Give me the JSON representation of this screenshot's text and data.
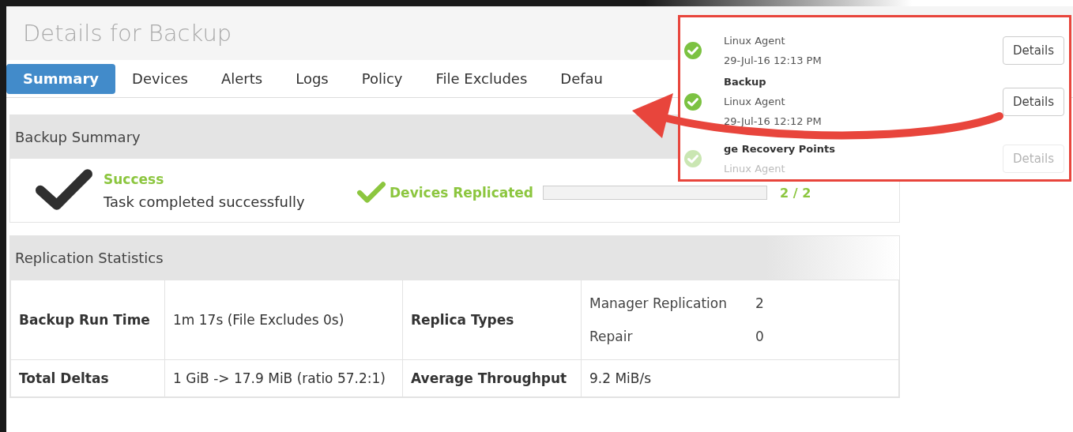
{
  "window": {
    "title": "Details for Backup"
  },
  "tabs": [
    {
      "label": "Summary",
      "selected": true
    },
    {
      "label": "Devices",
      "selected": false
    },
    {
      "label": "Alerts",
      "selected": false
    },
    {
      "label": "Logs",
      "selected": false
    },
    {
      "label": "Policy",
      "selected": false
    },
    {
      "label": "File Excludes",
      "selected": false
    },
    {
      "label": "Defau",
      "selected": false
    }
  ],
  "backup_summary": {
    "title": "Backup Summary",
    "status": "Success",
    "message": "Task completed successfully",
    "replicated": {
      "label": "Devices Replicated",
      "level": 0,
      "reading": "2 / 2"
    }
  },
  "replication_statistics": {
    "title": "Replication Statistics",
    "rows": [
      {
        "label_1": "Backup Run Time",
        "value_1": "1m 17s (File Excludes 0s)",
        "label_2": "Replica Types",
        "types": [
          {
            "name": "Manager Replication",
            "count": "2"
          },
          {
            "name": "Repair",
            "count": "0"
          }
        ]
      },
      {
        "label_1": "Total Deltas",
        "value_1": "1 GiB -> 17.9 MiB (ratio 57.2:1)",
        "label_2": "Average Throughput",
        "value_2": "9.2 MiB/s"
      }
    ]
  },
  "callout": {
    "items": [
      {
        "source": "Linux Agent",
        "time": "29-Jul-16 12:13 PM",
        "button": "Details",
        "faded": false
      },
      {
        "title": "Backup",
        "source": "Linux Agent",
        "time": "29-Jul-16 12:12 PM",
        "button": "Details",
        "faded": false
      },
      {
        "title": "ge Recovery Points",
        "source": "Linux Agent",
        "button": "Details",
        "faded": true
      }
    ]
  }
}
